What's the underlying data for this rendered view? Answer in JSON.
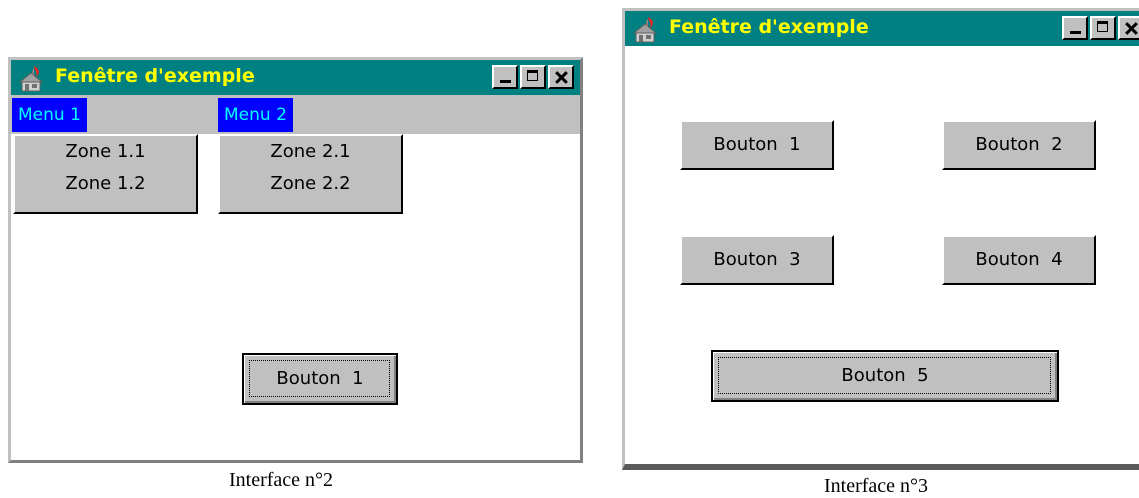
{
  "window_title": "Fenêtre d'exemple",
  "interface2": {
    "caption": "Interface n°2",
    "menus": [
      {
        "label": "Menu 1",
        "items": [
          "Zone 1.1",
          "Zone 1.2"
        ]
      },
      {
        "label": "Menu 2",
        "items": [
          "Zone 2.1",
          "Zone 2.2"
        ]
      }
    ],
    "button": "Bouton  1"
  },
  "interface3": {
    "caption": "Interface n°3",
    "buttons": [
      "Bouton  1",
      "Bouton  2",
      "Bouton  3",
      "Bouton  4",
      "Bouton  5"
    ]
  },
  "colors": {
    "titlebar": "#008080",
    "title_text": "#ffff00",
    "menu_bg": "#0000ff",
    "menu_text": "#00ffff",
    "button_face": "#c0c0c0"
  },
  "icons": [
    "app-icon",
    "minimize-icon",
    "maximize-icon",
    "close-icon"
  ]
}
